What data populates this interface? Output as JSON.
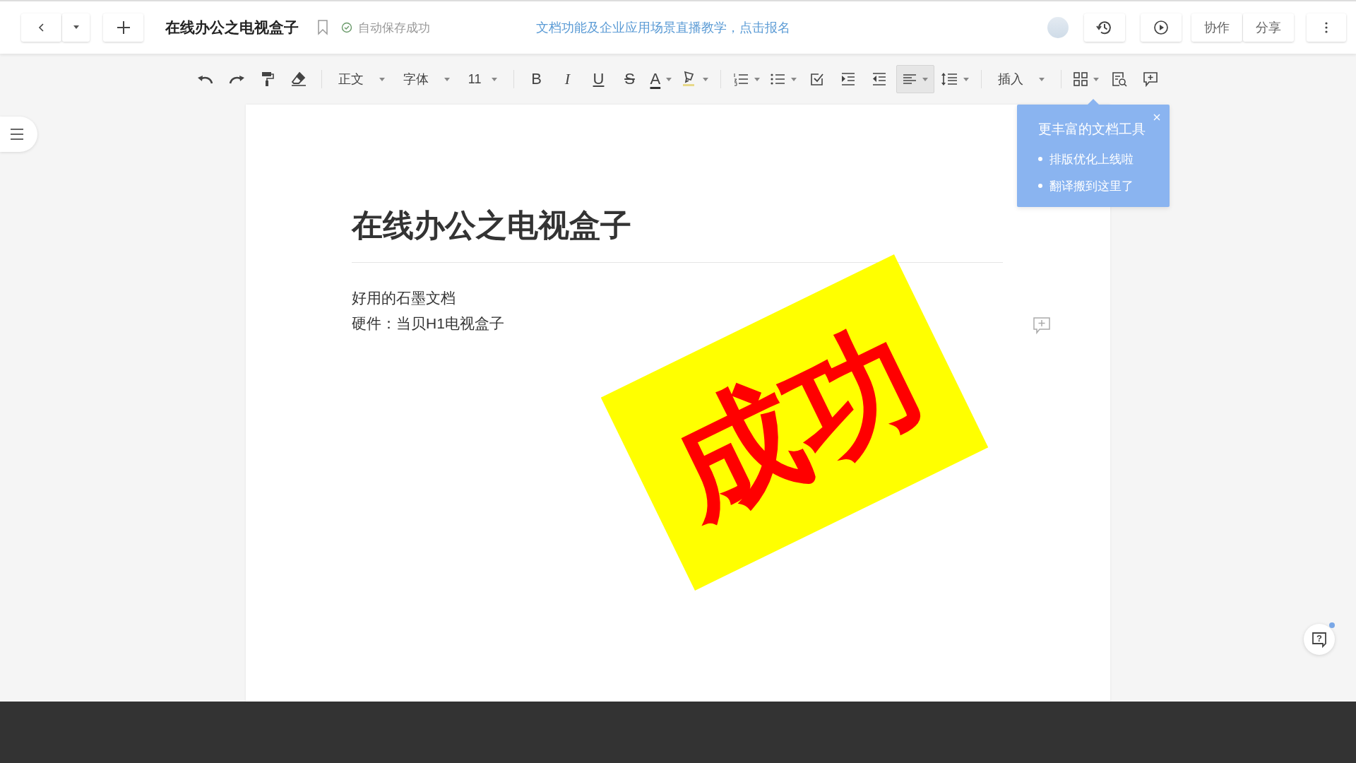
{
  "header": {
    "title": "在线办公之电视盒子",
    "save_status": "自动保存成功",
    "promo_link": "文档功能及企业应用场景直播教学，点击报名",
    "buttons": [
      "协作",
      "分享"
    ]
  },
  "toolbar": {
    "paragraph_style": "正文",
    "font": "字体",
    "font_size": "11",
    "bold": "B",
    "italic": "I",
    "underline": "U",
    "strikethrough": "S",
    "font_color": "A",
    "insert": "插入",
    "align_button": {
      "selected": true
    }
  },
  "tip": {
    "title": "更丰富的文档工具",
    "items": [
      "排版优化上线啦",
      "翻译搬到这里了"
    ]
  },
  "document": {
    "title": "在线办公之电视盒子",
    "paragraphs": [
      "好用的石墨文档",
      "硬件：当贝H1电视盒子"
    ]
  },
  "stamp": {
    "text": "成功"
  },
  "help_button": {
    "label": "?"
  }
}
